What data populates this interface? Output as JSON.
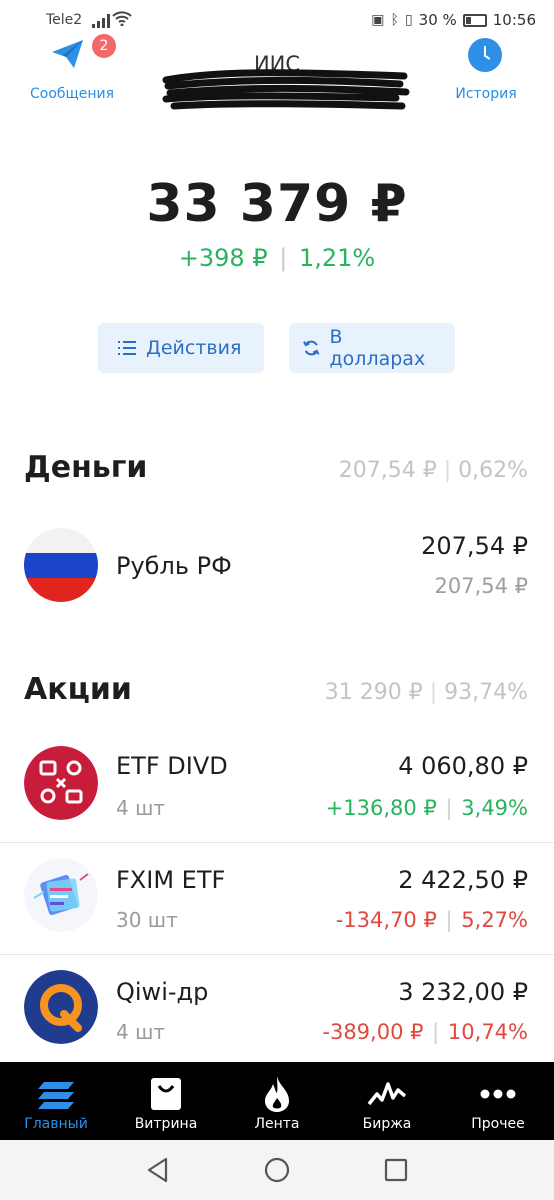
{
  "status_bar": {
    "carrier": "Tele2",
    "battery_percent": "30 %",
    "battery_level": 0.3,
    "time": "10:56",
    "icons": [
      "signal-icon",
      "wifi-icon",
      "nfc-icon",
      "bluetooth-icon",
      "vibrate-icon",
      "battery-icon"
    ]
  },
  "header": {
    "messages_label": "Сообщения",
    "messages_badge": "2",
    "title": "ИИС",
    "history_label": "История"
  },
  "portfolio": {
    "total": "33 379 ₽",
    "change_abs": "+398 ₽",
    "change_sep": "|",
    "change_pct": "1,21%"
  },
  "buttons": {
    "actions": "Действия",
    "in_dollars": "В долларах"
  },
  "money": {
    "title": "Деньги",
    "sum": "207,54 ₽",
    "sep": "|",
    "pct": "0,62%",
    "items": [
      {
        "name": "Рубль РФ",
        "value": "207,54 ₽",
        "sub": "207,54 ₽"
      }
    ]
  },
  "stocks": {
    "title": "Акции",
    "sum": "31 290 ₽",
    "sep": "|",
    "pct": "93,74%",
    "items": [
      {
        "name": "ETF DIVD",
        "qty": "4 шт",
        "value": "4 060,80 ₽",
        "change_abs": "+136,80 ₽",
        "change_pct": "3,49%",
        "trend": "up"
      },
      {
        "name": "FXIM ETF",
        "qty": "30 шт",
        "value": "2 422,50 ₽",
        "change_abs": "-134,70 ₽",
        "change_pct": "5,27%",
        "trend": "down"
      },
      {
        "name": "Qiwi-др",
        "qty": "4 шт",
        "value": "3 232,00 ₽",
        "change_abs": "-389,00 ₽",
        "change_pct": "10,74%",
        "trend": "down"
      }
    ]
  },
  "bottom_nav": [
    {
      "label": "Главный",
      "icon": "home-stack-icon",
      "active": true
    },
    {
      "label": "Витрина",
      "icon": "shopping-bag-icon",
      "active": false
    },
    {
      "label": "Лента",
      "icon": "flame-icon",
      "active": false
    },
    {
      "label": "Биржа",
      "icon": "chart-line-icon",
      "active": false
    },
    {
      "label": "Прочее",
      "icon": "more-dots-icon",
      "active": false
    }
  ],
  "colors": {
    "accent": "#2f8fe6",
    "positive": "#27b45d",
    "negative": "#e0493f",
    "badge": "#f2696b"
  }
}
